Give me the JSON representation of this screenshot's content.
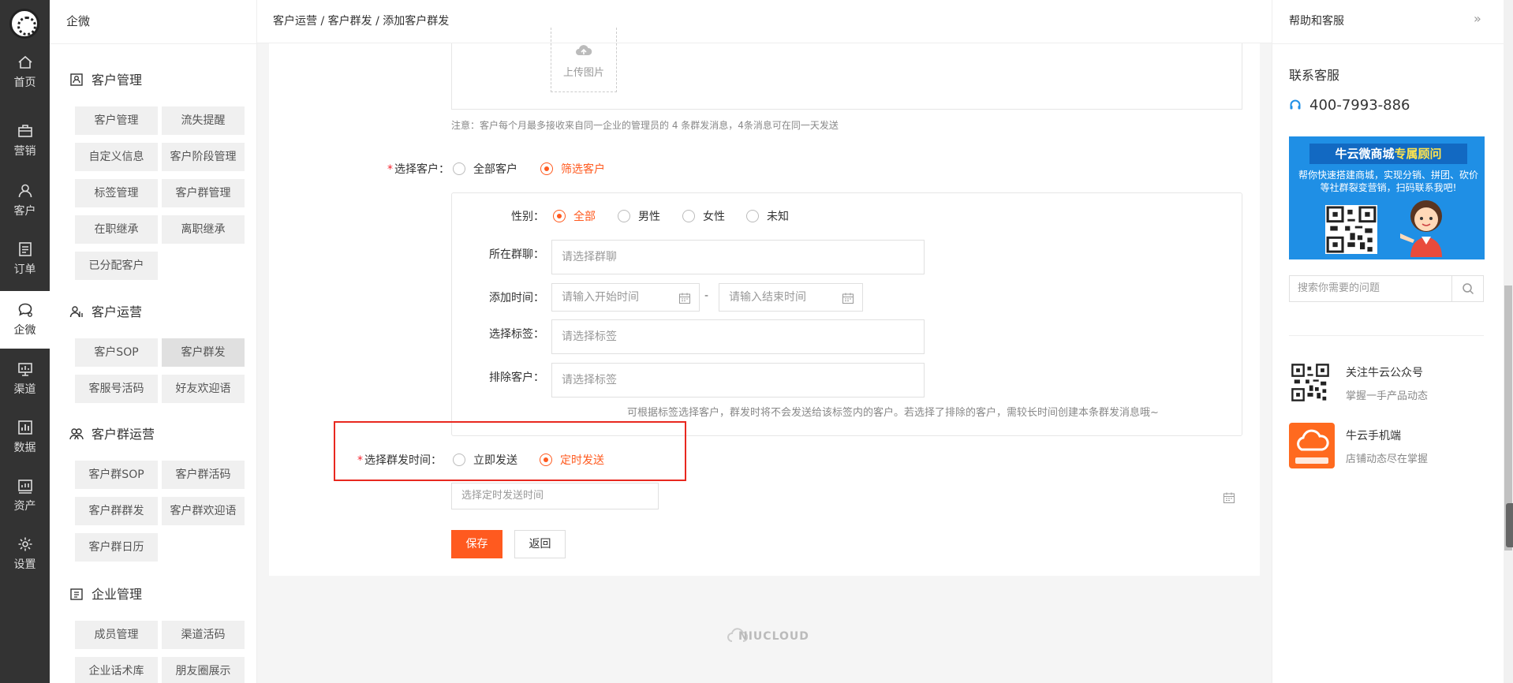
{
  "rail": {
    "items": [
      {
        "label": "首页",
        "icon": "home-icon"
      },
      {
        "label": "营销",
        "icon": "briefcase-icon"
      },
      {
        "label": "客户",
        "icon": "user-icon"
      },
      {
        "label": "订单",
        "icon": "order-icon"
      },
      {
        "label": "企微",
        "icon": "chat-icon"
      },
      {
        "label": "渠道",
        "icon": "monitor-icon"
      },
      {
        "label": "数据",
        "icon": "chart-icon"
      },
      {
        "label": "资产",
        "icon": "asset-icon"
      },
      {
        "label": "设置",
        "icon": "gear-icon"
      }
    ]
  },
  "submenu": {
    "title": "企微",
    "sections": [
      {
        "title": "客户管理",
        "items": [
          "客户管理",
          "流失提醒",
          "自定义信息",
          "客户阶段管理",
          "标签管理",
          "客户群管理",
          "在职继承",
          "离职继承",
          "已分配客户"
        ]
      },
      {
        "title": "客户运营",
        "items": [
          "客户SOP",
          "客户群发",
          "客服号活码",
          "好友欢迎语"
        ]
      },
      {
        "title": "客户群运营",
        "items": [
          "客户群SOP",
          "客户群活码",
          "客户群群发",
          "客户群欢迎语",
          "客户群日历"
        ]
      },
      {
        "title": "企业管理",
        "items": [
          "成员管理",
          "渠道活码",
          "企业话术库",
          "朋友圈展示"
        ]
      }
    ]
  },
  "breadcrumb": "客户运营 / 客户群发 / 添加客户群发",
  "form": {
    "upload_label": "上传图片",
    "note": "注意：客户每个月最多接收来自同一企业的管理员的 4 条群发消息，4条消息可在同一天发送",
    "select_customer": {
      "label": "选择客户：",
      "options": [
        "全部客户",
        "筛选客户"
      ],
      "selected": 1
    },
    "gender": {
      "label": "性别：",
      "options": [
        "全部",
        "男性",
        "女性",
        "未知"
      ],
      "selected": 0
    },
    "group_chat": {
      "label": "所在群聊：",
      "placeholder": "请选择群聊"
    },
    "add_time": {
      "label": "添加时间：",
      "start_placeholder": "请输入开始时间",
      "separator": "-",
      "end_placeholder": "请输入结束时间"
    },
    "select_tags": {
      "label": "选择标签：",
      "placeholder": "请选择标签"
    },
    "exclude": {
      "label": "排除客户：",
      "placeholder": "请选择标签"
    },
    "tip": "可根据标签选择客户，群发时将不会发送给该标签内的客户。若选择了排除的客户，需较长时间创建本条群发消息哦~",
    "send_time": {
      "label": "选择群发时间：",
      "options": [
        "立即发送",
        "定时发送"
      ],
      "selected": 1
    },
    "schedule_placeholder": "选择定时发送时间",
    "save": "保存",
    "back": "返回"
  },
  "footer_logo": "NIUCLOUD",
  "help": {
    "title": "帮助和客服",
    "collapse": "»",
    "contact_title": "联系客服",
    "phone": "400-7993-886",
    "banner_title_a": "牛云微商城",
    "banner_title_b": "专属顾问",
    "banner_desc": "帮你快速搭建商城，实现分销、拼团、砍价等社群裂变营销，扫码联系我吧!",
    "search_placeholder": "搜索你需要的问题",
    "promos": [
      {
        "title": "关注牛云公众号",
        "subtitle": "掌握一手产品动态"
      },
      {
        "title": "牛云手机端",
        "subtitle": "店铺动态尽在掌握"
      }
    ]
  },
  "colors": {
    "accent": "#ff5a1f",
    "rail_bg": "#333333",
    "highlight_border": "#e8281f",
    "banner_bg": "#1f8fe5"
  }
}
